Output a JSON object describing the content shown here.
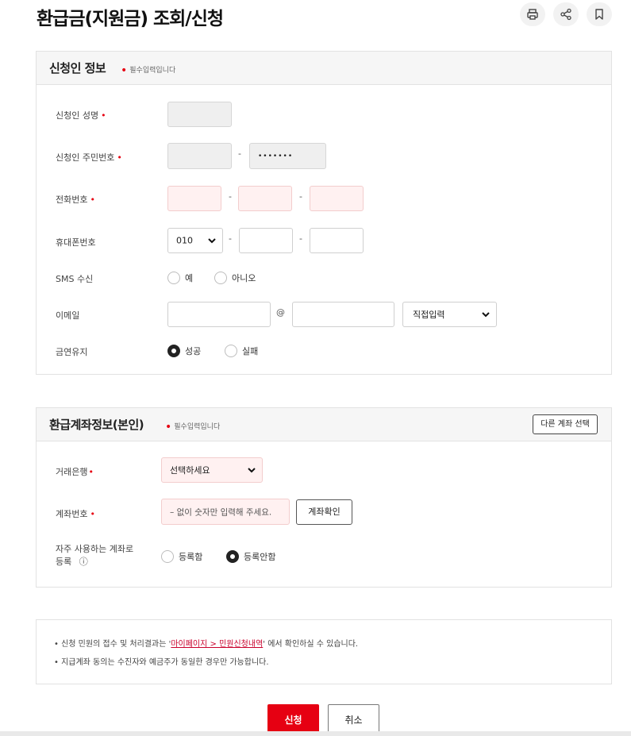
{
  "page": {
    "title": "환급금(지원금) 조회/신청",
    "tools": [
      {
        "icon": "print-icon"
      },
      {
        "icon": "share-icon"
      },
      {
        "icon": "bookmark-icon"
      }
    ]
  },
  "applicant_section": {
    "title": "신청인 정보",
    "required_note": "필수입력입니다",
    "name_label": "신청인 성명",
    "rrn_label": "신청인 주민번호",
    "rrn_back_masked": "•••••••",
    "phone_label": "전화번호",
    "mobile_label": "휴대폰번호",
    "mobile_prefix": "010",
    "sms_label": "SMS 수신",
    "sms_yes": "예",
    "sms_no": "아니오",
    "email_label": "이메일",
    "email_at": "@",
    "email_domain_select": "직접입력",
    "quit_label": "금연유지",
    "quit_success": "성공",
    "quit_fail": "실패",
    "dash": "-",
    "required_mark": "•"
  },
  "account_section": {
    "title": "환급계좌정보(본인)",
    "required_note": "필수입력입니다",
    "other_account_button": "다른 계좌 선택",
    "bank_label": "거래은행",
    "bank_select": "선택하세요",
    "account_label": "계좌번호",
    "account_placeholder": "– 없이 숫자만 입력해 주세요.",
    "verify_button": "계좌확인",
    "frequent_label_line1": "자주 사용하는 계좌로",
    "frequent_label_line2": "등록",
    "info_icon_glyph": "ⓘ",
    "register_yes": "등록함",
    "register_no": "등록안함"
  },
  "notice": {
    "line1_pre": "• 신청 민원의 접수 및 처리결과는 '",
    "line1_link": "마이페이지 > 민원신청내역",
    "line1_post": "' 에서 확인하실 수 있습니다.",
    "line2": "• 지급계좌 동의는 수진자와 예금주가 동일한 경우만 가능합니다."
  },
  "actions": {
    "submit": "신청",
    "cancel": "취소"
  },
  "colors": {
    "accent": "#e60012",
    "link": "#c9002b",
    "pink_field": "#fff1f1",
    "gray_field": "#efefef"
  }
}
